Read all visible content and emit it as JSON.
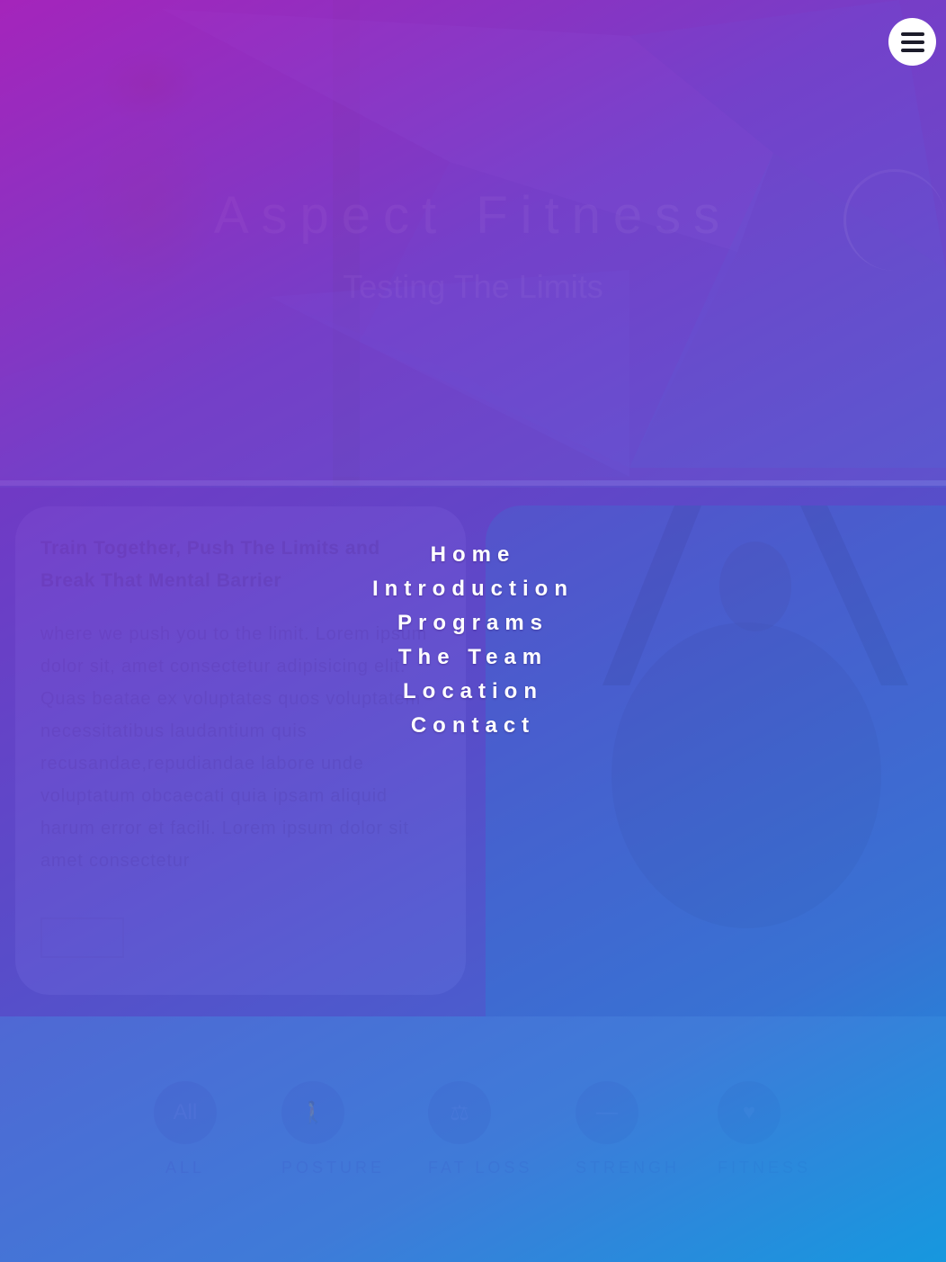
{
  "hero": {
    "title": "Aspect Fitness",
    "subtitle": "Testing The Limits"
  },
  "intro": {
    "heading": "Train Together, Push The Limits and Break That Mental Barrier",
    "body": "where we push you to the limit. Lorem ipsum dolor sit, amet consectetur adipisicing elit. Quas beatae ex voluptates quos voluptatem necessitatibus laudantium quis recusandae,repudiandae labore unde voluptatum obcaecati quia ipsam aliquid harum error et facili. Lorem ipsum dolor sit amet consectetur"
  },
  "programs": {
    "filters": [
      {
        "label": "ALL",
        "icon_text": "All",
        "icon": "all-icon"
      },
      {
        "label": "POSTURE",
        "icon_text": "",
        "icon": "person-icon"
      },
      {
        "label": "FAT LOSS",
        "icon_text": "",
        "icon": "scale-icon"
      },
      {
        "label": "STRENGH",
        "icon_text": "",
        "icon": "dumbbell-icon"
      },
      {
        "label": "FITNESS",
        "icon_text": "",
        "icon": "heart-icon"
      }
    ]
  },
  "nav": {
    "items": [
      "Home",
      "Introduction",
      "Programs",
      "The Team",
      "Location",
      "Contact"
    ],
    "menu_icon": "hamburger-icon"
  },
  "colors": {
    "gradient_start": "#b01fb8",
    "gradient_end": "#0e9ce0",
    "menu_button": "#ffffff"
  }
}
